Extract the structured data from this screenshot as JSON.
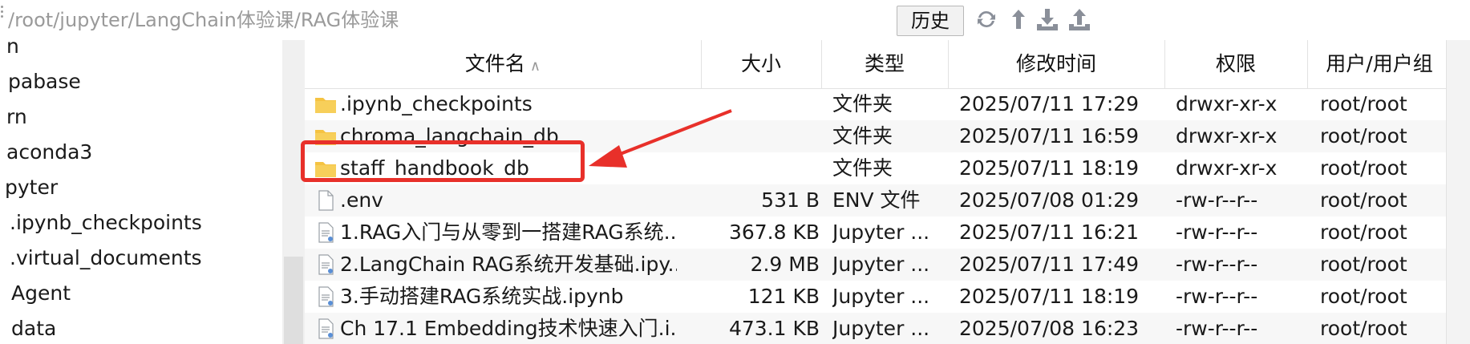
{
  "toolbar": {
    "path_placeholder": "/root/jupyter/LangChain体验课/RAG体验课",
    "history_label": "历史",
    "icons": [
      "refresh-icon",
      "upload-arrow-icon",
      "download-tray-icon",
      "upload-tray-icon"
    ]
  },
  "sidebar": {
    "items": [
      {
        "label": "n"
      },
      {
        "label": "pabase"
      },
      {
        "label": "rn"
      },
      {
        "label": "aconda3"
      },
      {
        "label": "pyter"
      },
      {
        "label": ".ipynb_checkpoints"
      },
      {
        "label": ".virtual_documents"
      },
      {
        "label": "Agent"
      },
      {
        "label": "data"
      }
    ]
  },
  "table": {
    "columns": {
      "name": "文件名",
      "size": "大小",
      "type": "类型",
      "modified": "修改时间",
      "perms": "权限",
      "owner": "用户/用户组"
    },
    "rows": [
      {
        "icon": "folder-icon",
        "name": ".ipynb_checkpoints",
        "size": "",
        "type": "文件夹",
        "modified": "2025/07/11 17:29",
        "perms": "drwxr-xr-x",
        "owner": "root/root"
      },
      {
        "icon": "folder-icon",
        "name": "chroma_langchain_db",
        "size": "",
        "type": "文件夹",
        "modified": "2025/07/11 16:59",
        "perms": "drwxr-xr-x",
        "owner": "root/root"
      },
      {
        "icon": "folder-icon",
        "name": "staff_handbook_db",
        "size": "",
        "type": "文件夹",
        "modified": "2025/07/11 18:19",
        "perms": "drwxr-xr-x",
        "owner": "root/root"
      },
      {
        "icon": "file-icon",
        "name": ".env",
        "size": "531 B",
        "type": "ENV 文件",
        "modified": "2025/07/08 01:29",
        "perms": "-rw-r--r--",
        "owner": "root/root"
      },
      {
        "icon": "notebook-icon",
        "name": "1.RAG入门与从零到一搭建RAG系统...",
        "size": "367.8 KB",
        "type": "Jupyter ...",
        "modified": "2025/07/11 16:21",
        "perms": "-rw-r--r--",
        "owner": "root/root"
      },
      {
        "icon": "notebook-icon",
        "name": "2.LangChain RAG系统开发基础.ipy...",
        "size": "2.9 MB",
        "type": "Jupyter ...",
        "modified": "2025/07/11 17:49",
        "perms": "-rw-r--r--",
        "owner": "root/root"
      },
      {
        "icon": "notebook-icon",
        "name": "3.手动搭建RAG系统实战.ipynb",
        "size": "121 KB",
        "type": "Jupyter ...",
        "modified": "2025/07/11 18:19",
        "perms": "-rw-r--r--",
        "owner": "root/root"
      },
      {
        "icon": "notebook-icon",
        "name": "Ch 17.1 Embedding技术快速入门.i...",
        "size": "473.1 KB",
        "type": "Jupyter ...",
        "modified": "2025/07/08 16:23",
        "perms": "-rw-r--r--",
        "owner": "root/root"
      }
    ]
  },
  "colors": {
    "annotation": "#e8302a",
    "folder": "#f5c342",
    "icon_gray": "#8a8f99"
  }
}
